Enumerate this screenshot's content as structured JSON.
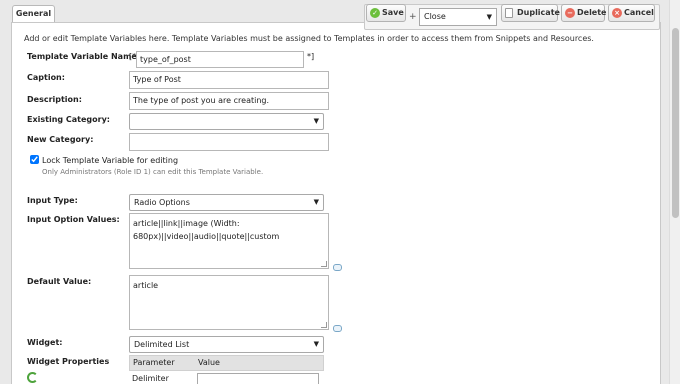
{
  "tab": {
    "label": "General"
  },
  "toolbar": {
    "save": "Save",
    "plus": "+",
    "close_select": "Close",
    "duplicate": "Duplicate",
    "delete": "Delete",
    "cancel": "Cancel"
  },
  "intro": "Add or edit Template Variables here. Template Variables must be assigned to Templates in order to access them from Snippets and Resources.",
  "form": {
    "name_label": "Template Variable Name:",
    "name_open": "[*",
    "name_value": "type_of_post",
    "name_close": "*]",
    "caption_label": "Caption:",
    "caption_value": "Type of Post",
    "description_label": "Description:",
    "description_value": "The type of post you are creating.",
    "existing_category_label": "Existing Category:",
    "existing_category_value": "",
    "new_category_label": "New Category:",
    "new_category_value": "",
    "lock_label": "Lock Template Variable for editing",
    "lock_checked": true,
    "lock_note": "Only Administrators (Role ID 1) can edit this Template Variable.",
    "input_type_label": "Input Type:",
    "input_type_value": "Radio Options",
    "input_options_label": "Input Option Values:",
    "input_options_value": "article||link||image (Width: 680px)||video||audio||quote||custom",
    "default_label": "Default Value:",
    "default_value": "article",
    "widget_label": "Widget:",
    "widget_value": "Delimited List",
    "widget_props_label": "Widget Properties",
    "wp_col_param": "Parameter",
    "wp_col_value": "Value",
    "wp_row_param": "Delimiter"
  }
}
